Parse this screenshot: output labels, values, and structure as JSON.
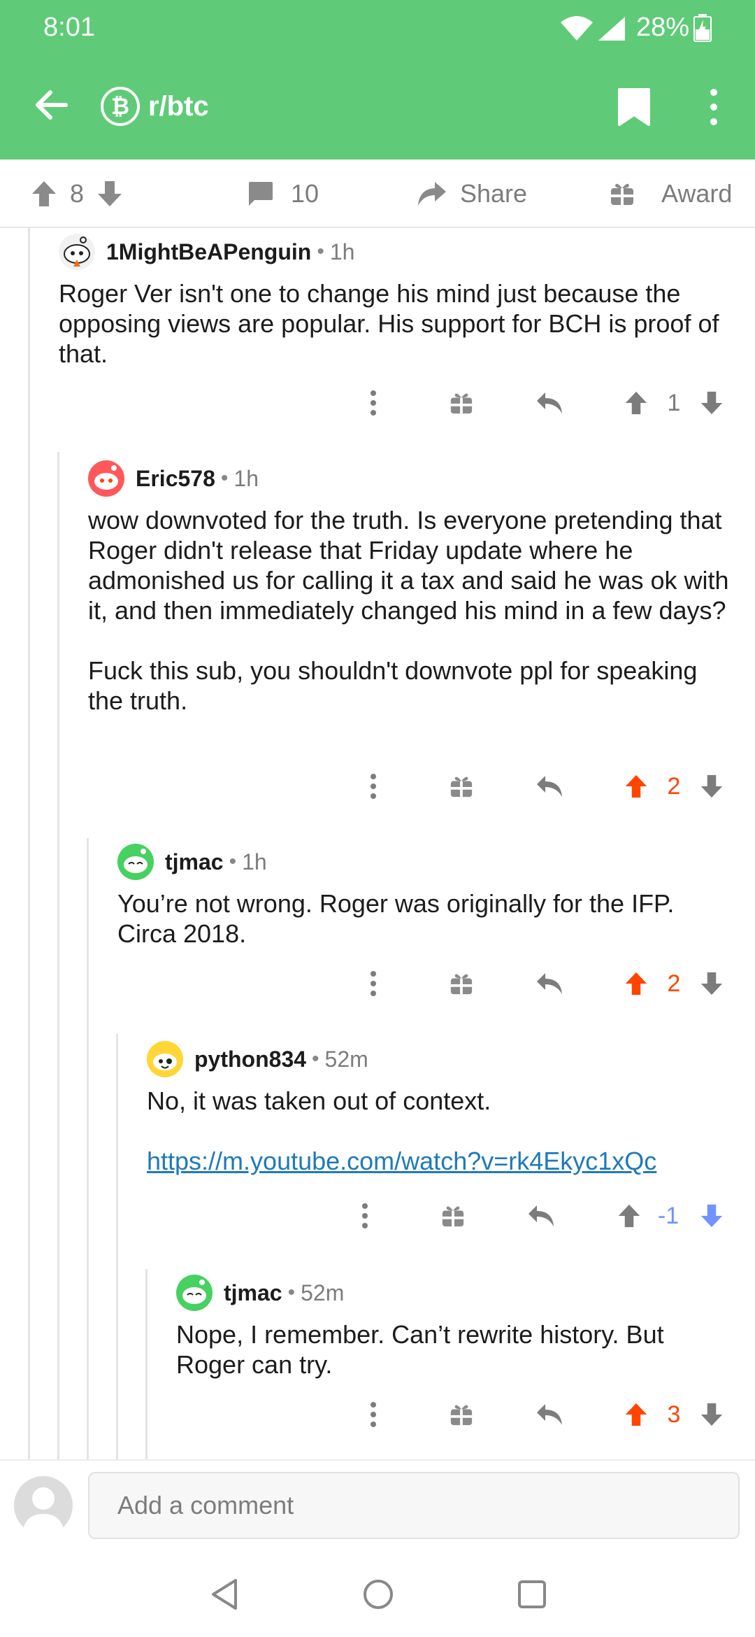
{
  "status_bar": {
    "time": "8:01",
    "battery": "28%"
  },
  "header": {
    "subreddit": "r/btc",
    "subreddit_icon": "bitcoin-icon"
  },
  "action_bar": {
    "score": "8",
    "comments": "10",
    "share_label": "Share",
    "award_label": "Award"
  },
  "comments": [
    {
      "author": "1MightBeAPenguin",
      "time": "1h",
      "body": [
        "Roger Ver isn't one to change his mind just because the opposing views are popular. His support for BCH is proof of that."
      ],
      "score": "1",
      "vote": "none"
    },
    {
      "author": "Eric578",
      "time": "1h",
      "body": [
        "wow downvoted for the truth.  Is everyone pretending that Roger didn't release that Friday update where he admonished us for calling it a tax and said he was ok with it, and then immediately changed his mind in a few days?",
        "Fuck this sub, you shouldn't downvote ppl for speaking the truth."
      ],
      "score": "2",
      "vote": "up"
    },
    {
      "author": "tjmac",
      "time": "1h",
      "body": [
        "You’re not wrong. Roger was originally for the IFP. Circa 2018."
      ],
      "score": "2",
      "vote": "up"
    },
    {
      "author": "python834",
      "time": "52m",
      "body": [
        "No, it was taken out of context."
      ],
      "link": "https://m.youtube.com/watch?v=rk4Ekyc1xQc",
      "score": "-1",
      "vote": "down"
    },
    {
      "author": "tjmac",
      "time": "52m",
      "body": [
        "Nope, I remember. Can’t rewrite history. But Roger can try."
      ],
      "score": "3",
      "vote": "up"
    }
  ],
  "comment_bar": {
    "placeholder": "Add a comment"
  },
  "colors": {
    "header": "#5fcb78",
    "upvote": "#ff4500",
    "downvote": "#7193ff",
    "link": "#1f7ab8"
  }
}
